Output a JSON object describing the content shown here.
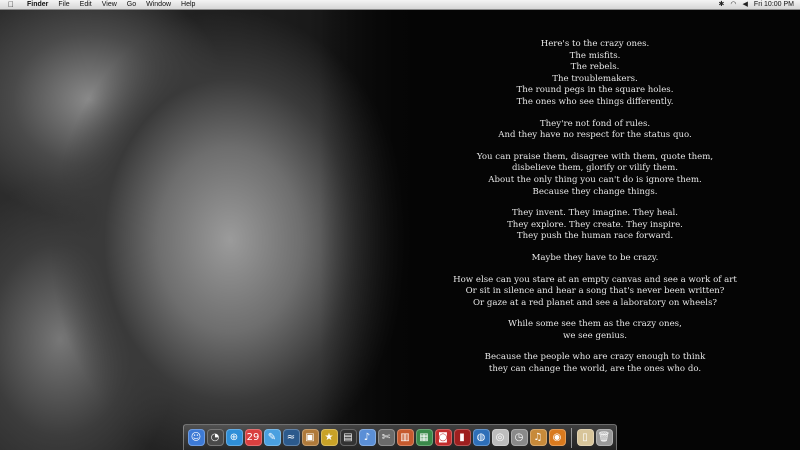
{
  "menubar": {
    "apple_icon": "apple-icon",
    "items": [
      "Finder",
      "File",
      "Edit",
      "View",
      "Go",
      "Window",
      "Help"
    ],
    "status_icons": [
      "bluetooth-icon",
      "wifi-icon",
      "volume-icon"
    ],
    "clock": "Fri 10:00 PM"
  },
  "poem": {
    "stanzas": [
      [
        "Here's to the crazy ones.",
        "The misfits.",
        "The rebels.",
        "The troublemakers.",
        "The round pegs in the square holes.",
        "The ones who see things differently."
      ],
      [
        "They're not fond of rules.",
        "And they have no respect for the status quo."
      ],
      [
        "You can praise them, disagree with them, quote them,",
        "disbelieve them, glorify or vilify them.",
        "About the only thing you can't do is ignore them.",
        "Because they change things."
      ],
      [
        "They invent. They imagine. They heal.",
        "They explore. They create. They inspire.",
        "They push the human race forward."
      ],
      [
        "Maybe they have to be crazy."
      ],
      [
        "How else can you stare at an empty canvas and see a work of art",
        "Or sit in silence and hear a song that's never been written?",
        "Or gaze at a red planet and see a laboratory on wheels?"
      ],
      [
        "While some see them as the crazy ones,",
        "we see genius."
      ],
      [
        "Because the people who are crazy enough to think",
        "they can change the world, are the ones who do."
      ]
    ]
  },
  "dock": {
    "apps": [
      {
        "icon": "finder-icon",
        "glyph": "☺",
        "color": "#3d7ad6"
      },
      {
        "icon": "dashboard-icon",
        "glyph": "◔",
        "color": "#4a4a4a"
      },
      {
        "icon": "safari-icon",
        "glyph": "⊕",
        "color": "#2f8fd8"
      },
      {
        "icon": "calendar-icon",
        "glyph": "29",
        "color": "#d94040"
      },
      {
        "icon": "ichat-icon",
        "glyph": "✎",
        "color": "#4aa0e0"
      },
      {
        "icon": "fish-app-icon",
        "glyph": "≈",
        "color": "#2c5a8c"
      },
      {
        "icon": "photo-app-icon",
        "glyph": "▣",
        "color": "#b07a3a"
      },
      {
        "icon": "star-app-icon",
        "glyph": "★",
        "color": "#c9a227"
      },
      {
        "icon": "clapboard-icon",
        "glyph": "▤",
        "color": "#333333"
      },
      {
        "icon": "itunes-icon",
        "glyph": "♪",
        "color": "#5b8fd6"
      },
      {
        "icon": "tools-icon",
        "glyph": "✄",
        "color": "#6b6b6b"
      },
      {
        "icon": "presentation-icon",
        "glyph": "▥",
        "color": "#c65a2e"
      },
      {
        "icon": "chart-app-icon",
        "glyph": "▦",
        "color": "#3a8a4a"
      },
      {
        "icon": "red-app-icon",
        "glyph": "◙",
        "color": "#c22d2d"
      },
      {
        "icon": "red-book-icon",
        "glyph": "▮",
        "color": "#9e1f1f"
      },
      {
        "icon": "globe-icon",
        "glyph": "◍",
        "color": "#2e6fb8"
      },
      {
        "icon": "disc-icon",
        "glyph": "◎",
        "color": "#bdbdbd"
      },
      {
        "icon": "time-machine-icon",
        "glyph": "◷",
        "color": "#8a8a8a"
      },
      {
        "icon": "guitar-icon",
        "glyph": "♫",
        "color": "#c78a3a"
      },
      {
        "icon": "radar-icon",
        "glyph": "◉",
        "color": "#d97a1e"
      }
    ],
    "stack_icons": [
      {
        "icon": "documents-stack-icon",
        "glyph": "▯",
        "color": "#d8c59a"
      },
      {
        "icon": "trash-icon",
        "glyph": "🗑",
        "color": "#9a9a9a"
      }
    ]
  }
}
